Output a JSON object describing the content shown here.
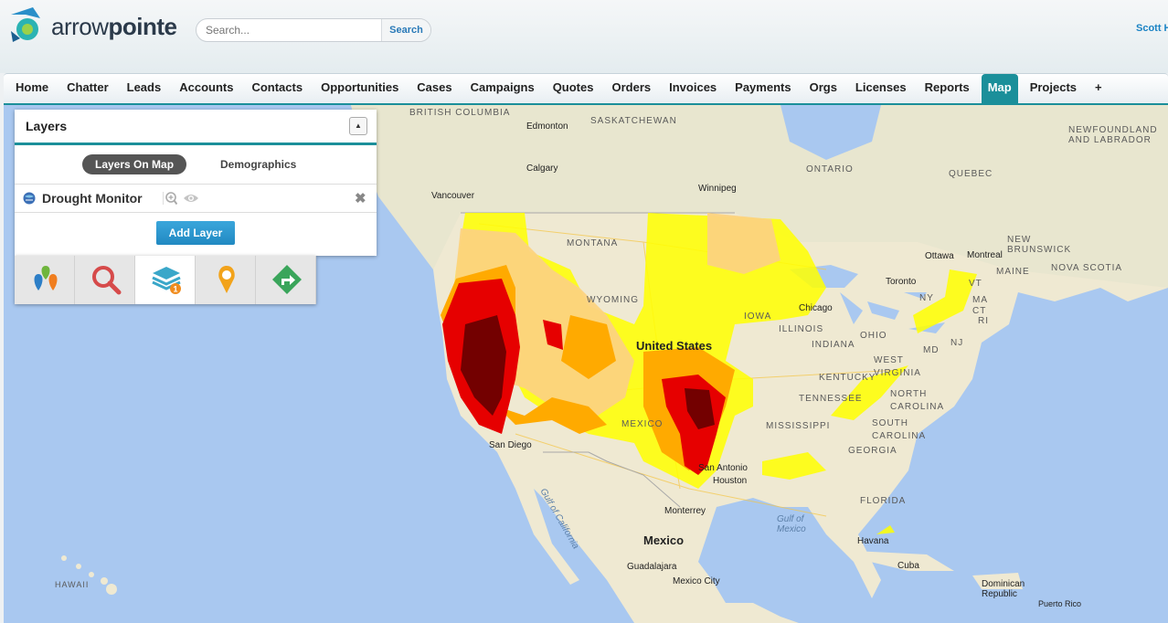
{
  "header": {
    "logo_text_light": "arrow",
    "logo_text_bold": "pointe",
    "search_placeholder": "Search...",
    "search_button": "Search",
    "user_name": "Scott H"
  },
  "nav": {
    "tabs": [
      "Home",
      "Chatter",
      "Leads",
      "Accounts",
      "Contacts",
      "Opportunities",
      "Cases",
      "Campaigns",
      "Quotes",
      "Orders",
      "Invoices",
      "Payments",
      "Orgs",
      "Licenses",
      "Reports",
      "Map",
      "Projects",
      "+"
    ],
    "active_tab": "Map"
  },
  "layers_panel": {
    "title": "Layers",
    "tabs": {
      "layers_on_map": "Layers On Map",
      "demographics": "Demographics"
    },
    "active_tab": "Layers On Map",
    "layer": {
      "name": "Drought Monitor",
      "icon": "globe-icon"
    },
    "add_layer_label": "Add Layer"
  },
  "tools": [
    {
      "name": "markers",
      "icon": "map-markers-icon"
    },
    {
      "name": "search",
      "icon": "search-icon"
    },
    {
      "name": "layers",
      "icon": "layers-icon",
      "badge": "1",
      "active": true
    },
    {
      "name": "pin",
      "icon": "pin-icon"
    },
    {
      "name": "directions",
      "icon": "directions-icon"
    }
  ],
  "map": {
    "labels": {
      "british_columbia": "BRITISH COLUMBIA",
      "saskatchewan": "SASKATCHEWAN",
      "edmonton": "Edmonton",
      "calgary": "Calgary",
      "vancouver": "Vancouver",
      "winnipeg": "Winnipeg",
      "ontario": "ONTARIO",
      "quebec": "QUEBEC",
      "newfoundland": "NEWFOUNDLAND\nAND LABRADOR",
      "montana": "MONTANA",
      "wyoming": "WYOMING",
      "new_brunswick": "NEW BRUNSWICK",
      "nova_scotia": "NOVA SCOTIA",
      "ottawa": "Ottawa",
      "montreal": "Montreal",
      "maine": "MAINE",
      "toronto": "Toronto",
      "chicago": "Chicago",
      "iowa": "IOWA",
      "illinois": "ILLINOIS",
      "ohio": "OHIO",
      "indiana": "INDIANA",
      "west_virginia": "WEST VIRGINIA",
      "kentucky": "KENTUCKY",
      "tennessee": "TENNESSEE",
      "north_carolina": "NORTH CAROLINA",
      "south_carolina": "SOUTH CAROLINA",
      "georgia": "GEORGIA",
      "mississippi": "MISSISSIPPI",
      "mexico_state": "MEXICO",
      "united_states": "United States",
      "houston": "Houston",
      "san_antonio": "San Antonio",
      "san_diego": "San Diego",
      "florida": "FLORIDA",
      "gulf_of_mexico": "Gulf of Mexico",
      "gulf_of_california": "Gulf of California",
      "monterrey": "Monterrey",
      "mexico": "Mexico",
      "guadalajara": "Guadalajara",
      "mexico_city": "Mexico City",
      "havana": "Havana",
      "cuba": "Cuba",
      "dominican_republic": "Dominican Republic",
      "puerto_rico": "Puerto Rico",
      "hawaii": "HAWAII",
      "md": "MD",
      "nj": "NJ",
      "vt": "VT",
      "ny": "NY",
      "ma": "MA",
      "ct": "CT",
      "ri": "RI"
    }
  },
  "colors": {
    "accent_teal": "#1b8f9a",
    "button_blue": "#2a8fc9",
    "water": "#a9c8f0",
    "land": "#f0ead3",
    "drought_d0": "#ffff00",
    "drought_d1": "#fcd37f",
    "drought_d2": "#ffaa00",
    "drought_d3": "#e60000",
    "drought_d4": "#730000"
  }
}
